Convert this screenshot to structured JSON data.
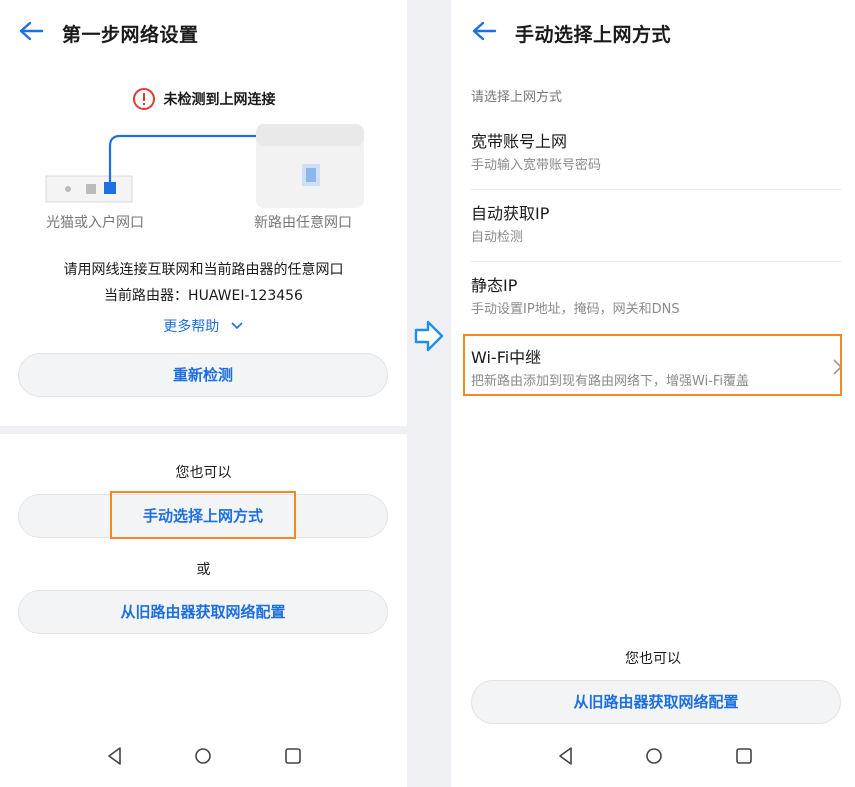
{
  "left": {
    "title": "第一步网络设置",
    "alert_text": "未检测到上网连接",
    "caption_left": "光猫或入户网口",
    "caption_right": "新路由任意网口",
    "instruction_line1": "请用网线连接互联网和当前路由器的任意网口",
    "instruction_line2": "当前路由器：HUAWEI-123456",
    "more_help": "更多帮助",
    "recheck_button": "重新检测",
    "also_can": "您也可以",
    "manual_button": "手动选择上网方式",
    "or_label": "或",
    "old_router_button": "从旧路由器获取网络配置"
  },
  "right": {
    "title": "手动选择上网方式",
    "section_label": "请选择上网方式",
    "options": [
      {
        "title": "宽带账号上网",
        "subtitle": "手动输入宽带账号密码"
      },
      {
        "title": "自动获取IP",
        "subtitle": "自动检测"
      },
      {
        "title": "静态IP",
        "subtitle": "手动设置IP地址，掩码，网关和DNS"
      },
      {
        "title": "Wi-Fi中继",
        "subtitle": "把新路由添加到现有路由网络下，增强Wi-Fi覆盖"
      }
    ],
    "also_can": "您也可以",
    "old_router_button": "从旧路由器获取网络配置"
  },
  "colors": {
    "accent": "#1e6fe0",
    "highlight": "#f08a24",
    "alert": "#e53935"
  },
  "icons": {
    "back": "arrow-left-icon",
    "alert": "exclamation-circle-icon",
    "chevron": "chevron-right-icon",
    "nav_back": "triangle-back-icon",
    "nav_home": "circle-home-icon",
    "nav_recent": "square-recent-icon",
    "transition": "arrow-right-outline-icon"
  }
}
